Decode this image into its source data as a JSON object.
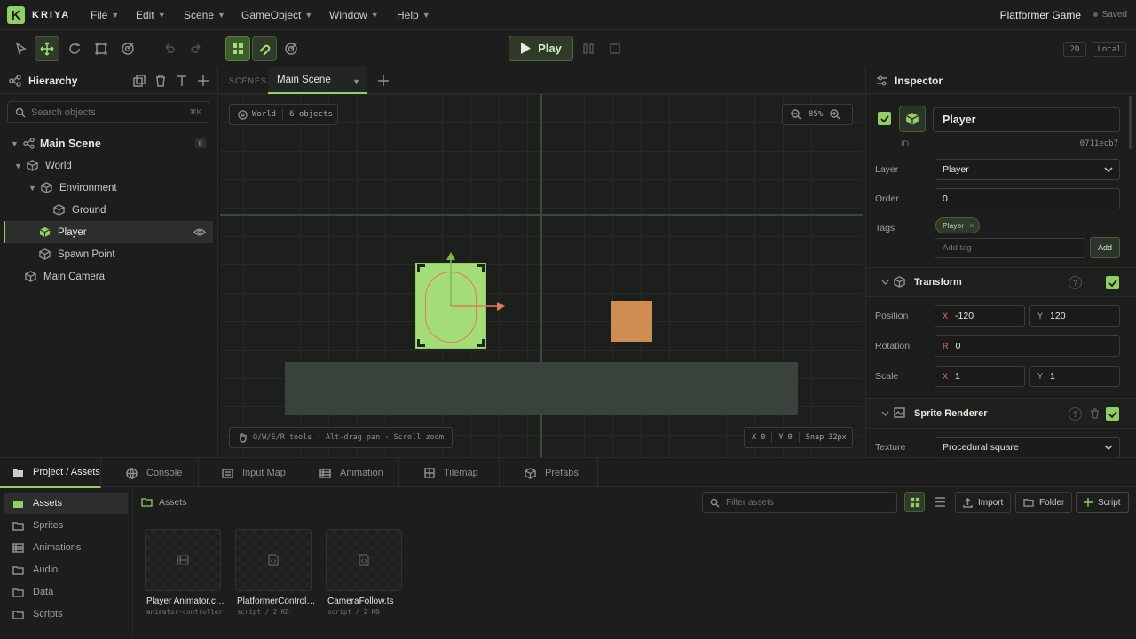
{
  "app": {
    "logo_letter": "K",
    "logo_text": "KRIYA",
    "project_title": "Platformer Game",
    "save_status": "Saved",
    "accent_color": "#91cf66"
  },
  "menu": [
    "File",
    "Edit",
    "Scene",
    "GameObject",
    "Window",
    "Help"
  ],
  "toolbar": {
    "tools": [
      "select-tool-icon",
      "move-tool-icon",
      "rotate-tool-icon",
      "scale-tool-icon",
      "rect-tool-icon"
    ],
    "play_label": "Play",
    "view_mode": "2D",
    "space_mode": "Local"
  },
  "hierarchy": {
    "title": "Hierarchy",
    "search_placeholder": "Search objects",
    "search_shortcut": "⌘K",
    "items": [
      {
        "label": "Main Scene",
        "badge": "6"
      },
      {
        "label": "World"
      },
      {
        "label": "Environment"
      },
      {
        "label": "Ground"
      },
      {
        "label": "Player"
      },
      {
        "label": "Spawn Point"
      },
      {
        "label": "Main Camera"
      }
    ]
  },
  "scene": {
    "tabs_label": "SCENES",
    "active_tab": "Main Scene",
    "world_label": "World",
    "objects_count": "6 objects",
    "zoom": "85%",
    "hint": "Q/W/E/R tools · Alt-drag pan · Scroll zoom",
    "coord_x": "X 0",
    "coord_y": "Y 0",
    "snap": "Snap 32px"
  },
  "inspector": {
    "title": "Inspector",
    "object_name": "Player",
    "id_label": "ID",
    "id_value": "0711ecb7",
    "layer_label": "Layer",
    "layer_value": "Player",
    "order_label": "Order",
    "order_value": "0",
    "tags_label": "Tags",
    "tag": "Player",
    "tag_placeholder": "Add tag",
    "add_tag_button": "Add",
    "transform": {
      "title": "Transform",
      "position_label": "Position",
      "position_x": "-120",
      "position_y": "120",
      "rotation_label": "Rotation",
      "rotation": "0",
      "scale_label": "Scale",
      "scale_x": "1",
      "scale_y": "1",
      "axis_x": "X",
      "axis_y": "Y",
      "axis_r": "R"
    },
    "sprite_renderer": {
      "title": "Sprite Renderer",
      "texture_label": "Texture",
      "texture_value": "Procedural square"
    }
  },
  "bottom": {
    "tabs": [
      "Project / Assets",
      "Console",
      "Input Map",
      "Animation",
      "Tilemap",
      "Prefabs"
    ],
    "folders": [
      "Assets",
      "Sprites",
      "Animations",
      "Audio",
      "Data",
      "Scripts"
    ],
    "breadcrumb": "Assets",
    "filter_placeholder": "Filter assets",
    "import_button": "Import",
    "folder_button": "Folder",
    "script_button": "Script",
    "assets": [
      {
        "name": "Player Animator.controller",
        "meta": "animator-controller"
      },
      {
        "name": "PlatformerController.ts",
        "meta": "script / 2 KB"
      },
      {
        "name": "CameraFollow.ts",
        "meta": "script / 2 KB"
      }
    ]
  }
}
